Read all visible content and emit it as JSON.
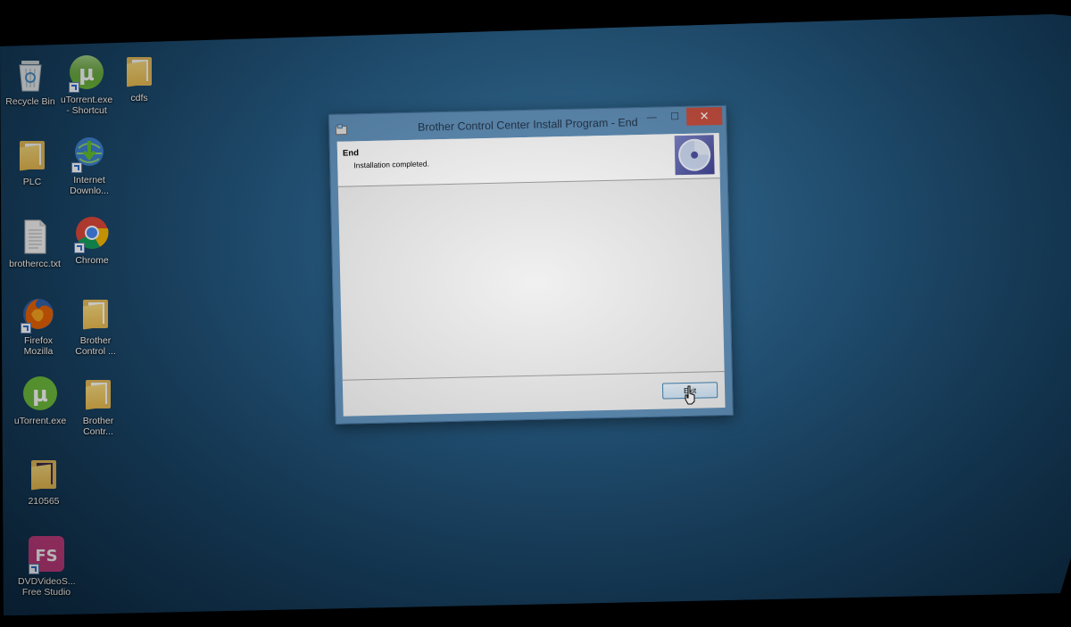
{
  "desktop": {
    "icons": [
      {
        "label": "Recycle Bin",
        "icon": "recycle-bin-icon"
      },
      {
        "label": "uTorrent.exe - Shortcut",
        "icon": "utorrent-icon"
      },
      {
        "label": "cdfs",
        "icon": "folder-icon"
      },
      {
        "label": "PLC",
        "icon": "folder-icon"
      },
      {
        "label": "Internet Downlo...",
        "icon": "internet-download-manager-icon"
      },
      {
        "label": "brothercc.txt",
        "icon": "text-file-icon"
      },
      {
        "label": "Chrome",
        "icon": "chrome-icon"
      },
      {
        "label": "Firefox Mozilla",
        "icon": "firefox-icon"
      },
      {
        "label": "Brother Control ...",
        "icon": "folder-icon"
      },
      {
        "label": "uTorrent.exe",
        "icon": "utorrent-icon"
      },
      {
        "label": "Brother Contr...",
        "icon": "folder-icon"
      },
      {
        "label": "210565",
        "icon": "folder-icon"
      },
      {
        "label": "DVDVideoS... Free Studio",
        "icon": "dvdvideosoft-icon"
      }
    ]
  },
  "window": {
    "title": "Brother Control Center Install Program - End",
    "header_title": "End",
    "header_subtitle": "Installation completed.",
    "exit_label": "Exit",
    "minimize_glyph": "—",
    "maximize_glyph": "☐",
    "close_glyph": "✕"
  },
  "colors": {
    "desktop_bg": "#1f547c",
    "window_frame": "#5d8eb8",
    "close_button": "#c94c3c",
    "utorrent_green": "#6cbc3a"
  }
}
